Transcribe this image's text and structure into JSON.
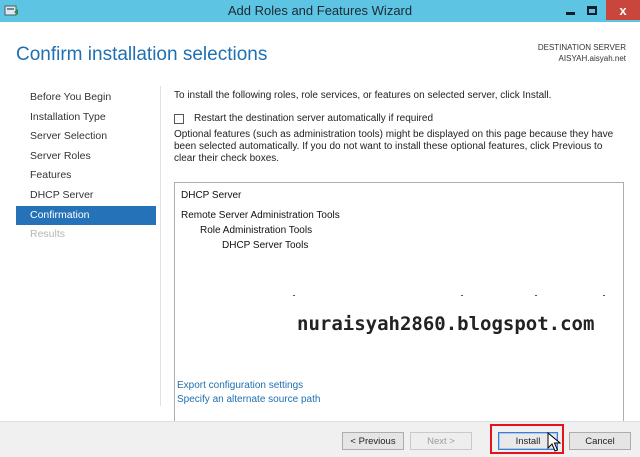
{
  "window": {
    "title": "Add Roles and Features Wizard",
    "controls": {
      "minimize_icon": "minimize-icon",
      "maximize_icon": "maximize-icon",
      "close_label": "x"
    }
  },
  "header": {
    "title": "Confirm installation selections",
    "destination_label": "DESTINATION SERVER",
    "destination_value": "AISYAH.aisyah.net"
  },
  "sidebar": {
    "items": [
      {
        "label": "Before You Begin",
        "state": "normal"
      },
      {
        "label": "Installation Type",
        "state": "normal"
      },
      {
        "label": "Server Selection",
        "state": "normal"
      },
      {
        "label": "Server Roles",
        "state": "normal"
      },
      {
        "label": "Features",
        "state": "normal"
      },
      {
        "label": "DHCP Server",
        "state": "normal"
      },
      {
        "label": "Confirmation",
        "state": "active"
      },
      {
        "label": "Results",
        "state": "disabled"
      }
    ]
  },
  "main": {
    "intro": "To install the following roles, role services, or features on selected server, click Install.",
    "restart_checkbox": {
      "label": "Restart the destination server automatically if required",
      "checked": false
    },
    "optional_note": "Optional features (such as administration tools) might be displayed on this page because they have been selected automatically. If you do not want to install these optional features, click Previous to clear their check boxes.",
    "selection_list": [
      "DHCP Server",
      "Remote Server Administration Tools",
      "Role Administration Tools",
      "DHCP Server Tools"
    ],
    "watermark": "nuraisyah2860.blogspot.com",
    "links": {
      "export": "Export configuration settings",
      "alternate_source": "Specify an alternate source path"
    }
  },
  "footer": {
    "previous": "< Previous",
    "next": "Next >",
    "install": "Install",
    "cancel": "Cancel"
  },
  "colors": {
    "titlebar": "#5dc5e3",
    "accent": "#1f6fb2",
    "active_nav": "#2672b9",
    "highlight_box": "#e3131b",
    "close_button": "#c9463d"
  }
}
